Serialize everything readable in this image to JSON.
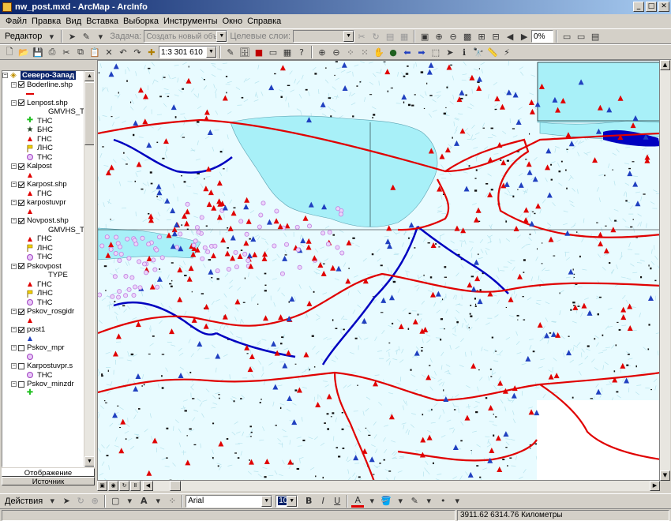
{
  "window": {
    "title": "nw_post.mxd - ArcMap - ArcInfo",
    "minimize": "_",
    "maximize": "□",
    "close": "✕"
  },
  "menu": [
    "Файл",
    "Правка",
    "Вид",
    "Вставка",
    "Выборка",
    "Инструменты",
    "Окно",
    "Справка"
  ],
  "editor": {
    "label": "Редактор",
    "task_label": "Задача:",
    "task_value": "Создать новый объе",
    "target_label": "Целевые слои:",
    "target_value": ""
  },
  "standard": {
    "scale": "1:3 301 610",
    "zoom_percent": "0%"
  },
  "toc": {
    "frame": "Северо-Запад",
    "layers": [
      {
        "name": "Boderline.shp",
        "checked": true,
        "legend": [
          {
            "icon": "red-line",
            "label": ""
          }
        ]
      },
      {
        "name": "Lenpost.shp",
        "checked": true,
        "legend": [
          {
            "icon": "field",
            "label": "GMVHS_T"
          },
          {
            "icon": "green-cross",
            "label": "ТНС"
          },
          {
            "icon": "dark-star",
            "label": "БНС"
          },
          {
            "icon": "red-triangle",
            "label": "ГНС"
          },
          {
            "icon": "yellow-flag",
            "label": "ЛНС"
          },
          {
            "icon": "purple-circle",
            "label": "ТНС"
          }
        ]
      },
      {
        "name": "Kalpost",
        "checked": true,
        "legend": [
          {
            "icon": "red-triangle",
            "label": ""
          }
        ]
      },
      {
        "name": "Karpost.shp",
        "checked": true,
        "legend": [
          {
            "icon": "red-triangle",
            "label": "ГНС"
          }
        ]
      },
      {
        "name": "karpostuvpr",
        "checked": true,
        "legend": [
          {
            "icon": "red-triangle",
            "label": ""
          }
        ]
      },
      {
        "name": "Novpost.shp",
        "checked": true,
        "legend": [
          {
            "icon": "field",
            "label": "GMVHS_T"
          },
          {
            "icon": "red-triangle",
            "label": "ГНС"
          },
          {
            "icon": "yellow-flag",
            "label": "ЛНС"
          },
          {
            "icon": "purple-circle",
            "label": "ТНС"
          }
        ]
      },
      {
        "name": "Pskovpost",
        "checked": true,
        "legend": [
          {
            "icon": "field",
            "label": "TYPE"
          },
          {
            "icon": "red-triangle",
            "label": "ГНС"
          },
          {
            "icon": "yellow-flag",
            "label": "ЛНС"
          },
          {
            "icon": "purple-circle",
            "label": "ТНС"
          }
        ]
      },
      {
        "name": "Pskov_rosgidr",
        "checked": true,
        "legend": [
          {
            "icon": "red-triangle",
            "label": ""
          }
        ]
      },
      {
        "name": "post1",
        "checked": true,
        "legend": [
          {
            "icon": "blue-triangle",
            "label": ""
          }
        ]
      },
      {
        "name": "Pskov_mpr",
        "checked": false,
        "legend": [
          {
            "icon": "purple-circle",
            "label": ""
          }
        ]
      },
      {
        "name": "Karpostuvpr.s",
        "checked": false,
        "legend": [
          {
            "icon": "purple-circle",
            "label": "ТНС"
          }
        ]
      },
      {
        "name": "Pskov_minzdr",
        "checked": false,
        "legend": [
          {
            "icon": "green-cross",
            "label": ""
          }
        ]
      }
    ],
    "tabs": [
      "Отображение",
      "Источник"
    ]
  },
  "draw": {
    "actions_label": "Действия",
    "font_name": "Arial",
    "font_size": "10",
    "bold": "B",
    "italic": "I",
    "underline": "U",
    "font_color": "A"
  },
  "status": {
    "coords": "3911.62  6314.76 Километры"
  },
  "colors": {
    "water": "#a8f0f8",
    "land": "#e0f8ff",
    "border": "#e00000",
    "river": "#0000c0",
    "station_red": "#e00000",
    "station_blue": "#2040c0",
    "station_purple": "#c080e0"
  }
}
